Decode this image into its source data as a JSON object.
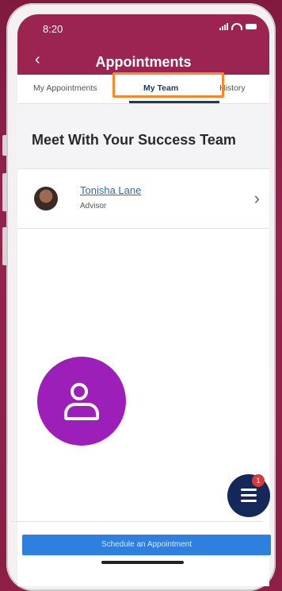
{
  "status": {
    "time": "8:20"
  },
  "header": {
    "title": "Appointments",
    "back_icon": "‹"
  },
  "tabs": [
    {
      "label": "My Appointments"
    },
    {
      "label": "My Team",
      "active": true
    },
    {
      "label": "History"
    }
  ],
  "section": {
    "title": "Meet With Your Success Team"
  },
  "team": [
    {
      "name": "Tonisha Lane",
      "role": "Advisor",
      "chevron": "›"
    }
  ],
  "fab": {
    "badge_count": "1"
  },
  "footer": {
    "schedule_label": "Schedule an Appointment"
  },
  "colors": {
    "brand": "#9b2451",
    "tab_active": "#1f3b63",
    "highlight": "#f08a2c",
    "badge_purple": "#9b1fb8",
    "fab": "#14285a",
    "button": "#2d7fe0"
  }
}
